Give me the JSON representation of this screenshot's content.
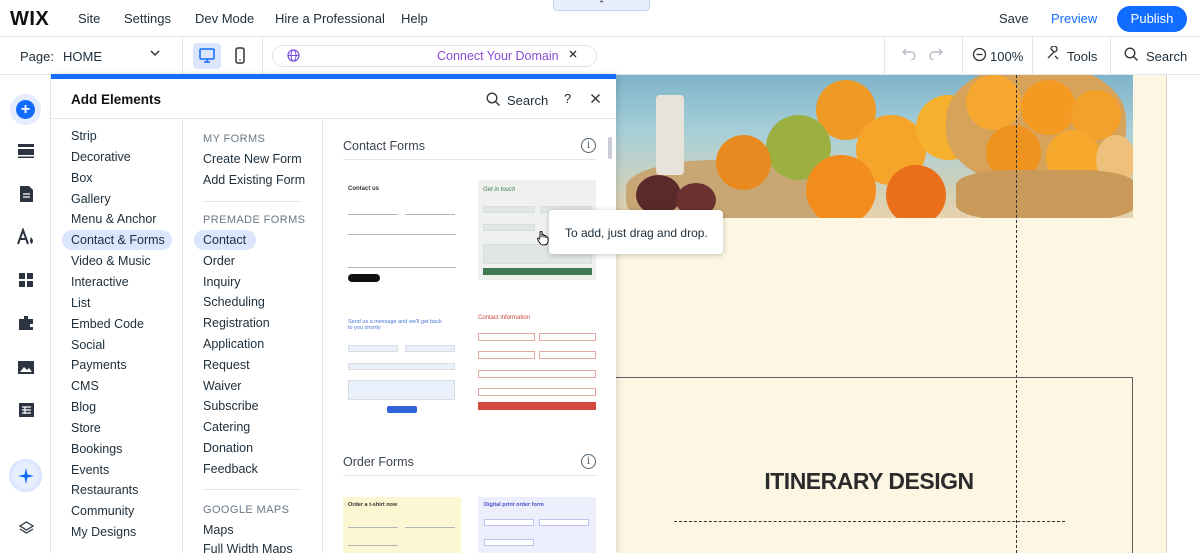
{
  "app": {
    "logo": "WIX"
  },
  "topbar": {
    "menu": [
      "Site",
      "Settings",
      "Dev Mode",
      "Hire a Professional",
      "Help"
    ],
    "notch": "⌃",
    "save": "Save",
    "preview": "Preview",
    "publish": "Publish"
  },
  "secondbar": {
    "page_label": "Page:",
    "page_value": "HOME",
    "domain_text": "Connect Your Domain",
    "zoom": "100%",
    "tools": "Tools",
    "search": "Search"
  },
  "panel": {
    "title": "Add Elements",
    "search": "Search",
    "help": "?",
    "categories": [
      "Strip",
      "Decorative",
      "Box",
      "Gallery",
      "Menu & Anchor",
      "Contact & Forms",
      "Video & Music",
      "Interactive",
      "List",
      "Embed Code",
      "Social",
      "Payments",
      "CMS",
      "Blog",
      "Store",
      "Bookings",
      "Events",
      "Restaurants",
      "Community",
      "My Designs"
    ],
    "active_category": "Contact & Forms",
    "sub": {
      "my_forms_heading": "MY FORMS",
      "my_forms": [
        "Create New Form",
        "Add Existing Form"
      ],
      "premade_heading": "PREMADE FORMS",
      "premade": [
        "Contact",
        "Order",
        "Inquiry",
        "Scheduling",
        "Registration",
        "Application",
        "Request",
        "Waiver",
        "Subscribe",
        "Catering",
        "Donation",
        "Feedback"
      ],
      "maps_heading": "GOOGLE MAPS",
      "maps": [
        "Maps",
        "Full Width Maps"
      ]
    },
    "sections": {
      "contact_forms": "Contact Forms",
      "order_forms": "Order Forms"
    },
    "thumbs": {
      "t1_title": "Contact us",
      "t2_title": "Get in touch",
      "t3_title": "Send us a message and we'll get back to you shortly",
      "t4_title": "Contact information",
      "t5_title": "Order a t-shirt now",
      "t6_title": "Digital print order form"
    },
    "tooltip": "To add, just drag and drop."
  },
  "canvas": {
    "section_title": "ITINERARY DESIGN"
  },
  "colors": {
    "accent": "#116dff",
    "domain": "#8a4cd6",
    "page_bg": "#fdf6e3"
  }
}
